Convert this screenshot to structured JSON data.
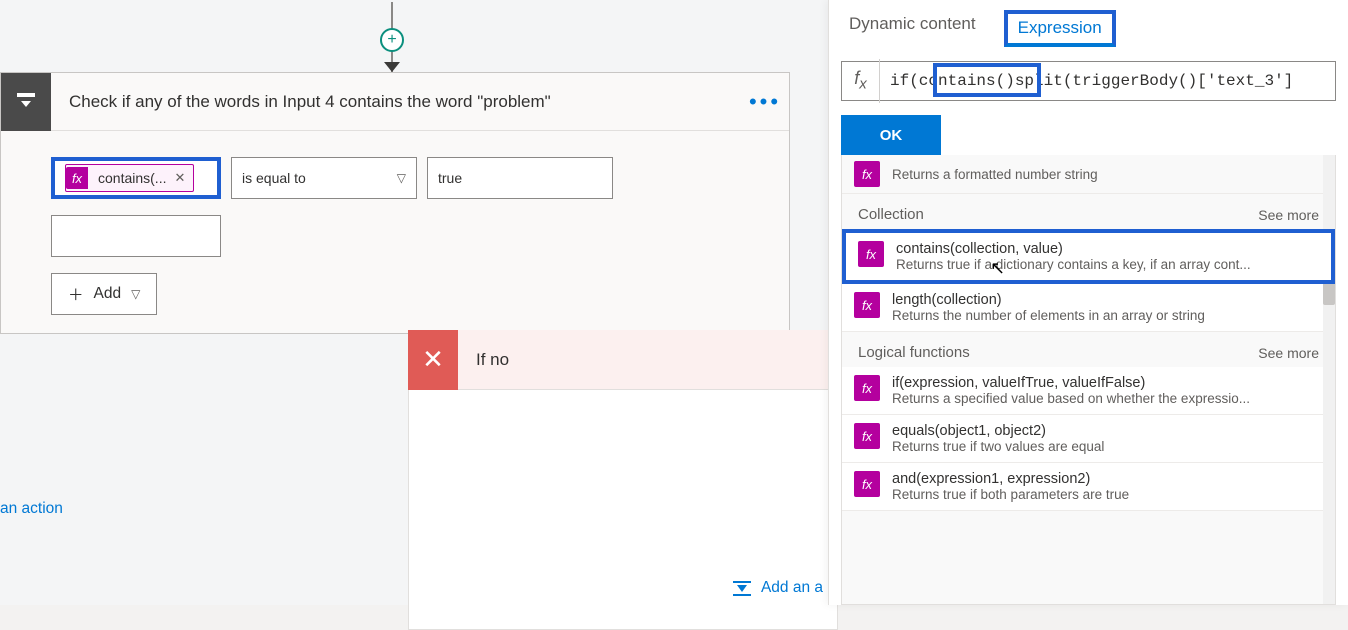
{
  "flow": {
    "condition_title": "Check if any of the words in Input 4 contains the word \"problem\"",
    "left_token": "contains(...",
    "operator": "is equal to",
    "right_value": "true",
    "add_label": "Add"
  },
  "branches": {
    "no_label": "If no",
    "add_action": "Add an a",
    "left_add_action": "an action"
  },
  "panel": {
    "tab_dynamic": "Dynamic content",
    "tab_expression": "Expression",
    "expression_value": "if(contains()split(triggerBody()['text_3']",
    "ok": "OK",
    "row_formatted_desc": "Returns a formatted number string",
    "cat_collection": "Collection",
    "see_more": "See more",
    "fn_contains_name": "contains(collection, value)",
    "fn_contains_desc": "Returns true if a dictionary contains a key, if an array cont...",
    "fn_length_name": "length(collection)",
    "fn_length_desc": "Returns the number of elements in an array or string",
    "cat_logical": "Logical functions",
    "fn_if_name": "if(expression, valueIfTrue, valueIfFalse)",
    "fn_if_desc": "Returns a specified value based on whether the expressio...",
    "fn_equals_name": "equals(object1, object2)",
    "fn_equals_desc": "Returns true if two values are equal",
    "fn_and_name": "and(expression1, expression2)",
    "fn_and_desc": "Returns true if both parameters are true"
  }
}
